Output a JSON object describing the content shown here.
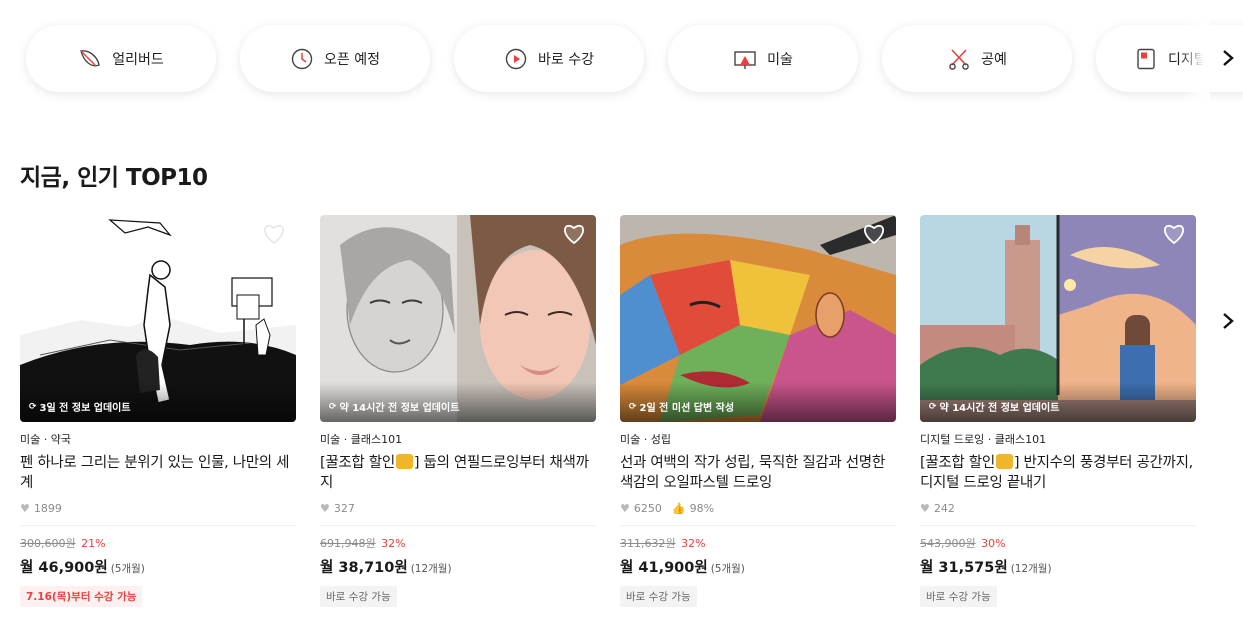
{
  "categories": [
    {
      "label": "얼리버드",
      "icon": "leaf-icon"
    },
    {
      "label": "오픈 예정",
      "icon": "clock-icon"
    },
    {
      "label": "바로 수강",
      "icon": "play-circle-icon"
    },
    {
      "label": "미술",
      "icon": "easel-icon"
    },
    {
      "label": "공예",
      "icon": "scissors-icon"
    },
    {
      "label": "디지털",
      "icon": "tablet-icon"
    }
  ],
  "section": {
    "title": "지금, 인기 TOP10"
  },
  "cards": [
    {
      "status": "3일 전 정보 업데이트",
      "category": "미술 · 약국",
      "title": "펜 하나로 그리는 분위기 있는 인물, 나만의 세계",
      "likes": "1899",
      "rating": "",
      "original_price": "300,600원",
      "discount": "21%",
      "monthly_price": "월 46,900원",
      "installment": "(5개월)",
      "badge": "7.16(목)부터 수강 가능",
      "badge_style": "red",
      "liked": false
    },
    {
      "status": "약 14시간 전 정보 업데이트",
      "category": "미술 · 클래스101",
      "title_prefix": "[꿀조합 할인",
      "title_suffix": "] 둡의 연필드로잉부터 채색까지",
      "likes": "327",
      "rating": "",
      "original_price": "691,948원",
      "discount": "32%",
      "monthly_price": "월 38,710원",
      "installment": "(12개월)",
      "badge": "바로 수강 가능",
      "badge_style": "grey",
      "liked": false
    },
    {
      "status": "2일 전 미션 답변 작성",
      "category": "미술 · 성립",
      "title": "선과 여백의 작가 성립, 묵직한 질감과 선명한 색감의 오일파스텔 드로잉",
      "likes": "6250",
      "rating": "98%",
      "original_price": "311,632원",
      "discount": "32%",
      "monthly_price": "월 41,900원",
      "installment": "(5개월)",
      "badge": "바로 수강 가능",
      "badge_style": "grey",
      "liked": false
    },
    {
      "status": "약 14시간 전 정보 업데이트",
      "category": "디지털 드로잉 · 클래스101",
      "title_prefix": "[꿀조합 할인",
      "title_suffix": "] 반지수의 풍경부터 공간까지,디지털 드로잉 끝내기",
      "likes": "242",
      "rating": "",
      "original_price": "543,900원",
      "discount": "30%",
      "monthly_price": "월 31,575원",
      "installment": "(12개월)",
      "badge": "바로 수강 가능",
      "badge_style": "grey",
      "liked": false
    }
  ],
  "colors": {
    "accent": "#e8413e",
    "muted": "#8c8c8c"
  }
}
